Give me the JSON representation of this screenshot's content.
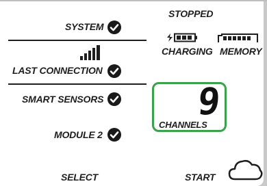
{
  "status": {
    "state": "STOPPED"
  },
  "left_panel": {
    "system_label": "SYSTEM",
    "last_connection_label": "LAST CONNECTION",
    "smart_sensors_label": "SMART SENSORS",
    "module_label": "MODULE 2"
  },
  "indicators": {
    "charging_label": "CHARGING",
    "memory_label": "MEMORY"
  },
  "channels": {
    "count": "9",
    "label": "CHANNELS"
  },
  "softkeys": {
    "select_label": "SELECT",
    "start_label": "START"
  },
  "icons": {
    "system_check": "check-circle-icon",
    "signal": "signal-bars-icon",
    "battery": "battery-icon",
    "memory": "memory-icon",
    "cloud": "cloud-icon"
  },
  "colors": {
    "highlight": "#3aa24a",
    "ink": "#1e1e1e"
  }
}
